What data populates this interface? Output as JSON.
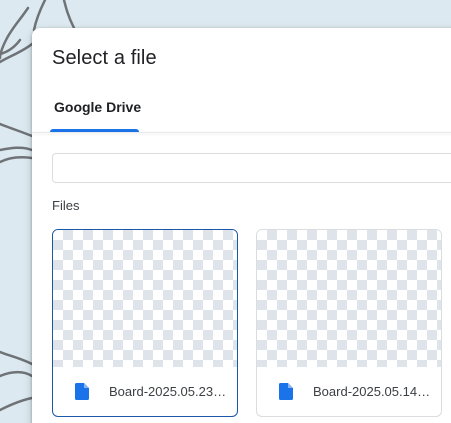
{
  "dialog": {
    "title": "Select a file",
    "tabs": [
      {
        "label": "Google Drive",
        "active": true
      }
    ],
    "search": {
      "value": "",
      "placeholder": ""
    },
    "section_label": "Files",
    "files": [
      {
        "name": "Board-2025.05.23-...",
        "selected": true,
        "icon": "doc-icon"
      },
      {
        "name": "Board-2025.05.14-...",
        "selected": false,
        "icon": "doc-icon"
      }
    ]
  },
  "colors": {
    "accent": "#1a73e8",
    "selected_border": "#1b57a8",
    "file_icon": "#1a73e8",
    "backdrop": "#dce9f0"
  }
}
